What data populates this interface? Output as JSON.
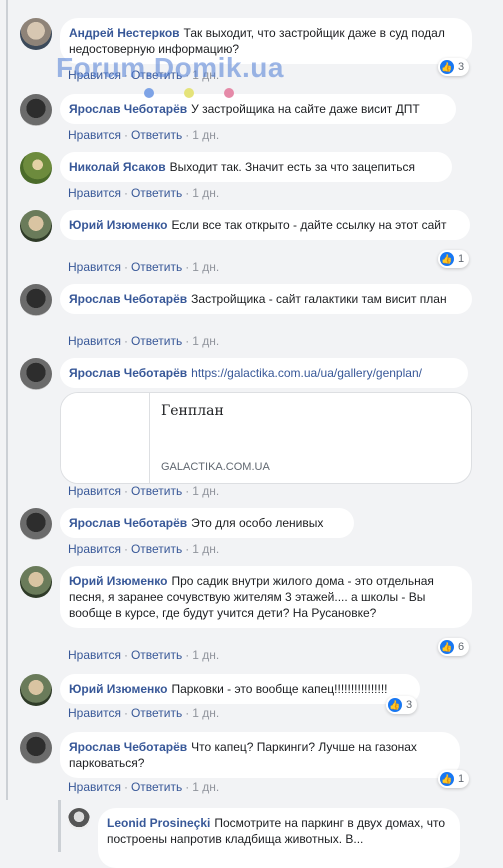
{
  "watermark": "Forum.Domik.ua",
  "accent": "#385898",
  "like_color": "#1877f2",
  "comments": [
    {
      "author": "Андрей Нестерков",
      "text": "Так выходит, что застройщик даже в суд подал недостоверную информацию?",
      "like": "Нравится",
      "reply": "Ответить",
      "time": "1 дн.",
      "reactions": "3"
    },
    {
      "author": "Ярослав Чеботарёв",
      "text": "У застройщика на сайте даже висит ДПТ",
      "like": "Нравится",
      "reply": "Ответить",
      "time": "1 дн."
    },
    {
      "author": "Николай Ясаков",
      "text": "Выходит так. Значит есть за что зацепиться",
      "like": "Нравится",
      "reply": "Ответить",
      "time": "1 дн."
    },
    {
      "author": "Юрий Изюменко",
      "text": "Если все так открыто - дайте ссылку на этот сайт",
      "like": "Нравится",
      "reply": "Ответить",
      "time": "1 дн.",
      "reactions": "1"
    },
    {
      "author": "Ярослав Чеботарёв",
      "text": "Застройщика - сайт галактики там висит план",
      "like": "Нравится",
      "reply": "Ответить",
      "time": "1 дн."
    },
    {
      "author": "Ярослав Чеботарёв",
      "text": "https://galactika.com.ua/ua/gallery/genplan/",
      "like": "Нравится",
      "reply": "Ответить",
      "time": "1 дн.",
      "card_title": "Генплан",
      "card_domain": "GALACTIKA.COM.UA"
    },
    {
      "author": "Ярослав Чеботарёв",
      "text": "Это для особо ленивых",
      "like": "Нравится",
      "reply": "Ответить",
      "time": "1 дн."
    },
    {
      "author": "Юрий Изюменко",
      "text": "Про садик внутри жилого дома - это отдельная песня, я заранее сочувствую жителям 3 этажей.... а школы - Вы вообще в курсе, где будут учится дети? На Русановке?",
      "like": "Нравится",
      "reply": "Ответить",
      "time": "1 дн.",
      "reactions": "6"
    },
    {
      "author": "Юрий Изюменко",
      "text": "Парковки - это вообще капец!!!!!!!!!!!!!!!!",
      "like": "Нравится",
      "reply": "Ответить",
      "time": "1 дн.",
      "reactions": "3"
    },
    {
      "author": "Ярослав Чеботарёв",
      "text": "Что капец? Паркинги? Лучше на газонах парковаться?",
      "like": "Нравится",
      "reply": "Ответить",
      "time": "1 дн.",
      "reactions": "1"
    },
    {
      "author": "Leonid Prosineçki",
      "text": "Посмотрите на паркинг в двух домах, что построены напротив кладбища животных. В...",
      "like": "",
      "reply": "",
      "time": ""
    }
  ]
}
